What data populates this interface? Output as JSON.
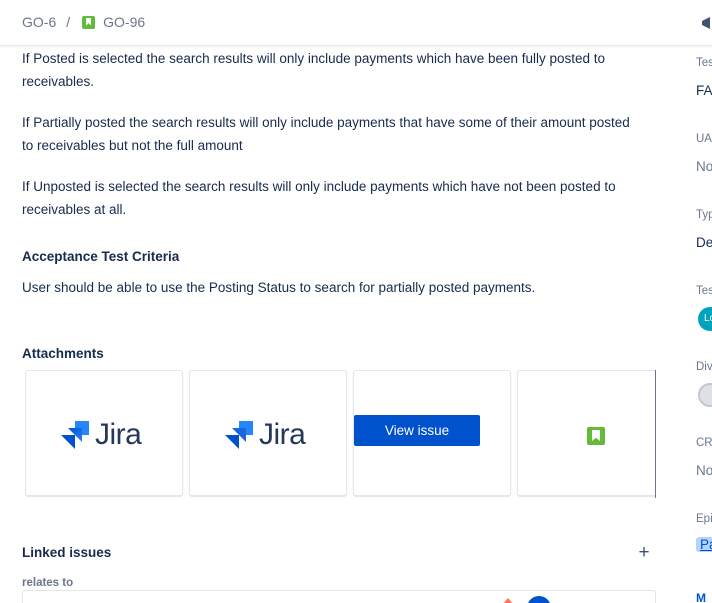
{
  "header": {
    "breadcrumb": {
      "parent": "GO-6",
      "separator": "/",
      "current": "GO-96"
    }
  },
  "description": {
    "p1": "If Posted is selected the search results will only include payments which have been fully posted to receivables.",
    "p2": "If Partially posted the search results will only include payments that have some of their amount posted to receivables but not the full amount",
    "p3": "If Unposted is selected the search results will only include payments which have not been posted to receivables at all.",
    "acceptance_heading": "Acceptance Test Criteria",
    "acceptance_text": "User should be able to use the Posting Status to search for partially posted payments."
  },
  "attachments": {
    "heading": "Attachments",
    "cards": [
      {
        "word": "Jira"
      },
      {
        "word": "Jira"
      },
      {
        "button": "View issue"
      },
      {
        "icon": "story-icon"
      }
    ]
  },
  "linked_issues": {
    "heading": "Linked issues",
    "add_label": "+",
    "relation": "relates to"
  },
  "sidebar": {
    "fields": [
      {
        "label": "Tes",
        "value": "FA"
      },
      {
        "label": "UA",
        "value": "No"
      },
      {
        "label": "Typ",
        "value": "De"
      },
      {
        "label": "Tes",
        "value": "Lo"
      },
      {
        "label": "Div",
        "value": ""
      },
      {
        "label": "CR",
        "value": "No"
      },
      {
        "label": "Epi",
        "value": "Pa"
      }
    ],
    "more": "M"
  },
  "colors": {
    "accent": "#0052cc",
    "story": "#63ba3c",
    "text": "#172b4d",
    "muted": "#6b778c"
  }
}
